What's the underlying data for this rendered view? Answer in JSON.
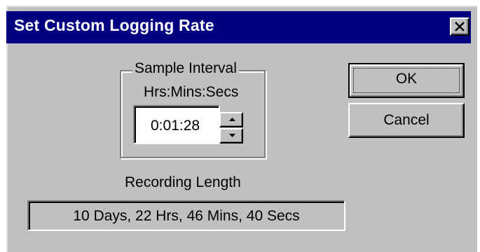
{
  "dialog": {
    "title": "Set Custom Logging Rate",
    "close_icon": "close-x-icon"
  },
  "sample_interval": {
    "group_label": "Sample Interval",
    "format_label": "Hrs:Mins:Secs",
    "value": "0:01:28",
    "spin_up_icon": "triangle-up-icon",
    "spin_down_icon": "triangle-down-icon"
  },
  "buttons": {
    "ok_label": "OK",
    "cancel_label": "Cancel"
  },
  "recording": {
    "label": "Recording Length",
    "value": "10 Days, 22 Hrs, 46 Mins, 40 Secs"
  },
  "colors": {
    "titlebar": "#000080",
    "face": "#c0c0c0"
  }
}
